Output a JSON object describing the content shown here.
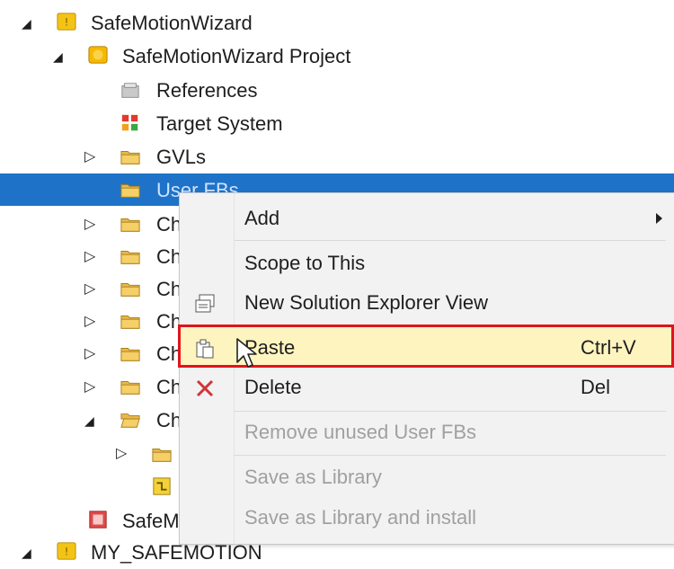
{
  "tree": {
    "root1": {
      "label": "SafeMotionWizard"
    },
    "project": {
      "label": "SafeMotionWizard Project"
    },
    "references": {
      "label": "References"
    },
    "target_system": {
      "label": "Target System"
    },
    "gvls": {
      "label": "GVLs"
    },
    "user_fbs": {
      "label": "User FBs"
    },
    "channel_rows": [
      "Ch",
      "Ch",
      "Ch",
      "Ch",
      "Ch",
      "Ch",
      "Ch"
    ],
    "safe_item": {
      "label": "SafeM"
    },
    "root2": {
      "label": "MY_SAFEMOTION"
    }
  },
  "context_menu": {
    "items": [
      {
        "label": "Add",
        "shortcut": "",
        "enabled": true,
        "submenu": true
      },
      {
        "label": "Scope to This",
        "shortcut": "",
        "enabled": true
      },
      {
        "label": "New Solution Explorer View",
        "shortcut": "",
        "enabled": true
      },
      {
        "label": "Paste",
        "shortcut": "Ctrl+V",
        "enabled": true,
        "highlighted": true
      },
      {
        "label": "Delete",
        "shortcut": "Del",
        "enabled": true
      },
      {
        "label": "Remove unused User FBs",
        "shortcut": "",
        "enabled": false
      },
      {
        "label": "Save as Library",
        "shortcut": "",
        "enabled": false
      },
      {
        "label": "Save as Library and install",
        "shortcut": "",
        "enabled": false
      }
    ]
  },
  "colors": {
    "selection": "#1e73c8",
    "highlight": "#fdf4bf",
    "annotation_box": "#e0141e",
    "delete_icon": "#d13438"
  }
}
